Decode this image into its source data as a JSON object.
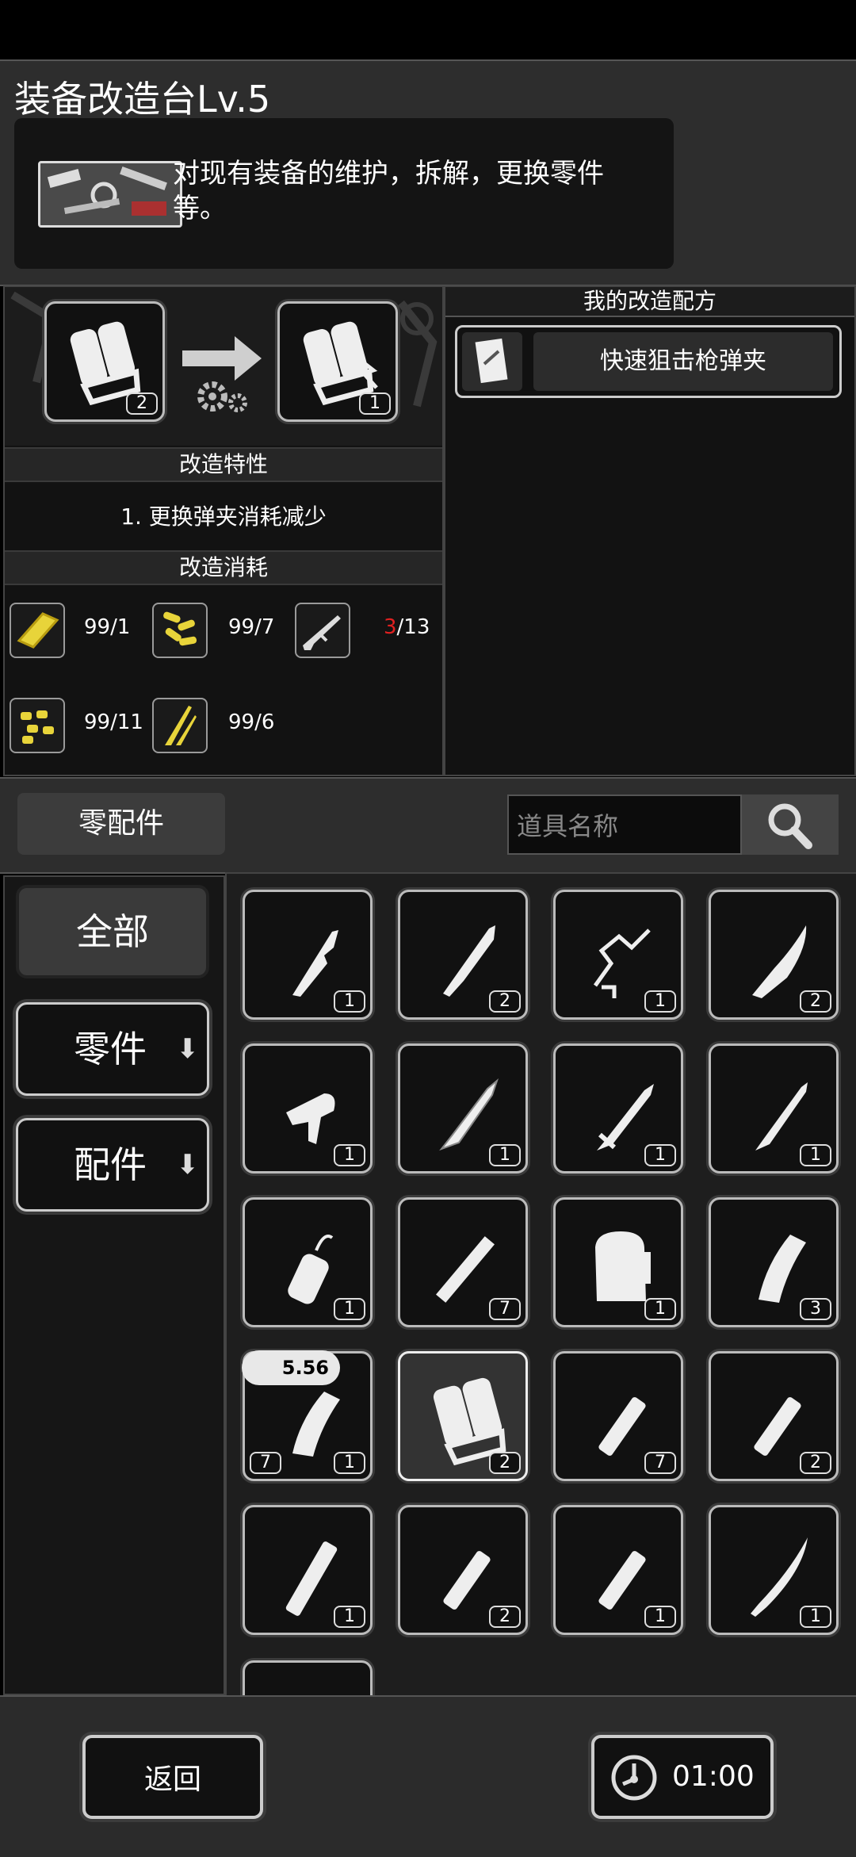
{
  "station": {
    "title": "装备改造台Lv.5",
    "description": "对现有装备的维护，拆解，更换零件等。"
  },
  "modify": {
    "source_count": "2",
    "result_count": "1",
    "traits_header": "改造特性",
    "trait_1": "1. 更换弹夹消耗减少",
    "cost_header": "改造消耗",
    "costs": [
      {
        "icon": "gold-bar-icon",
        "owned": "99",
        "required": "/1",
        "color": "#e8d43a"
      },
      {
        "icon": "bullets-pile-icon",
        "owned": "99",
        "required": "/7",
        "color": "#e8d43a"
      },
      {
        "icon": "rifle-icon",
        "owned": "3",
        "required": "/13",
        "owned_color": "#e02020"
      },
      {
        "icon": "nuts-icon",
        "owned": "99",
        "required": "/11",
        "color": "#e8d43a"
      },
      {
        "icon": "blade-shards-icon",
        "owned": "99",
        "required": "/6",
        "color": "#e8d43a"
      }
    ]
  },
  "recipes": {
    "header": "我的改造配方",
    "items": [
      {
        "label": "快速狙击枪弹夹",
        "icon": "recipe-scroll-icon"
      }
    ]
  },
  "filter": {
    "tab_label": "零配件",
    "search_placeholder": "道具名称"
  },
  "categories": [
    {
      "label": "全部",
      "selected": true
    },
    {
      "label": "零件",
      "arrow": "⬇"
    },
    {
      "label": "配件",
      "arrow": "⬇"
    }
  ],
  "inventory": [
    {
      "icon": "broken-blade-icon",
      "count": "1"
    },
    {
      "icon": "machete-blade-icon",
      "count": "2"
    },
    {
      "icon": "wire-spring-icon",
      "count": "1"
    },
    {
      "icon": "curved-blade-icon",
      "count": "2"
    },
    {
      "icon": "trigger-icon",
      "count": "1"
    },
    {
      "icon": "serrated-dagger-icon",
      "count": "1"
    },
    {
      "icon": "short-sword-icon",
      "count": "1"
    },
    {
      "icon": "long-blade-icon",
      "count": "1"
    },
    {
      "icon": "gas-canister-icon",
      "count": "1"
    },
    {
      "icon": "metal-rod-icon",
      "count": "7"
    },
    {
      "icon": "magazine-pouch-icon",
      "count": "1"
    },
    {
      "icon": "curved-magazine-icon",
      "count": "3"
    },
    {
      "icon": "rifle-magazine-icon",
      "count": "1",
      "ammo_label": "5.56",
      "extra_count": "7"
    },
    {
      "icon": "drum-magazine-icon",
      "count": "2",
      "selected": true
    },
    {
      "icon": "tube-icon",
      "count": "7"
    },
    {
      "icon": "tube-icon",
      "count": "2"
    },
    {
      "icon": "long-tube-icon",
      "count": "1"
    },
    {
      "icon": "tube-icon",
      "count": "2"
    },
    {
      "icon": "tube-icon",
      "count": "1"
    },
    {
      "icon": "katana-icon",
      "count": "1"
    }
  ],
  "footer": {
    "back_label": "返回",
    "timer": "01:00"
  }
}
